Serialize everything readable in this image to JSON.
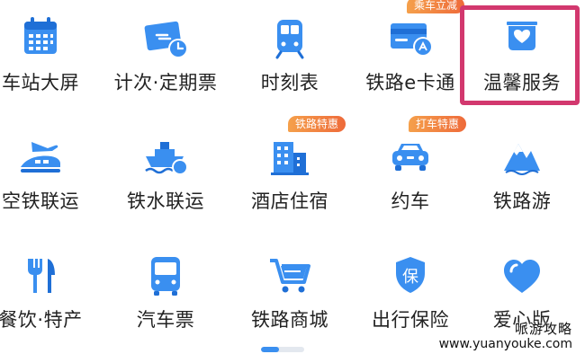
{
  "colors": {
    "primary": "#3a8ff0",
    "dark": "#1f6fd6",
    "badge": "#ee6a3a",
    "highlight": "#d2386e"
  },
  "rows": [
    [
      {
        "label": "车站大屏",
        "icon": "calendar-icon"
      },
      {
        "label": "计次·定期票",
        "icon": "ticket-clock-icon"
      },
      {
        "label": "时刻表",
        "icon": "train-icon"
      },
      {
        "label": "铁路e卡通",
        "icon": "railway-card-icon",
        "badge": "乘车立减"
      },
      {
        "label": "温馨服务",
        "icon": "heart-box-icon"
      }
    ],
    [
      {
        "label": "空铁联运",
        "icon": "plane-train-icon"
      },
      {
        "label": "铁水联运",
        "icon": "ship-train-icon"
      },
      {
        "label": "酒店住宿",
        "icon": "hotel-icon",
        "badge": "铁路特惠"
      },
      {
        "label": "约车",
        "icon": "car-icon",
        "badge": "打车特惠"
      },
      {
        "label": "铁路游",
        "icon": "mountain-icon"
      }
    ],
    [
      {
        "label": "餐饮·特产",
        "icon": "fork-knife-icon"
      },
      {
        "label": "汽车票",
        "icon": "bus-icon"
      },
      {
        "label": "铁路商城",
        "icon": "cart-icon"
      },
      {
        "label": "出行保险",
        "icon": "shield-bao-icon"
      },
      {
        "label": "爱心版",
        "icon": "heart-icon"
      }
    ]
  ],
  "badge_glyph_bao": "保",
  "watermark": {
    "line1": "哌游攻略",
    "line2": "www.yuanyouke.com"
  }
}
